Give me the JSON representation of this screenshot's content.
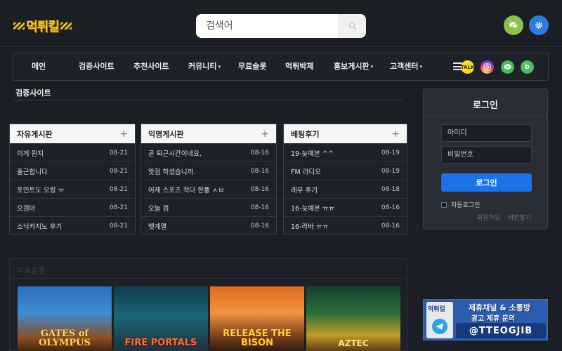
{
  "header": {
    "logo_text": "먹튀킬",
    "search": {
      "placeholder": "검색어",
      "button_icon": "search-icon"
    },
    "buttons": [
      {
        "icon": "chat-icon",
        "color": "#8bc34a"
      },
      {
        "icon": "gear-icon",
        "color": "#2f7de1"
      }
    ]
  },
  "nav": {
    "items": [
      {
        "label": "메인",
        "dropdown": false
      },
      {
        "label": "검증사이트",
        "dropdown": false
      },
      {
        "label": "추천사이트",
        "dropdown": false
      },
      {
        "label": "커뮤니티",
        "dropdown": true
      },
      {
        "label": "무료슬롯",
        "dropdown": false
      },
      {
        "label": "먹튀박제",
        "dropdown": false
      },
      {
        "label": "홍보게시판",
        "dropdown": true
      },
      {
        "label": "고객센터",
        "dropdown": true
      }
    ],
    "caret": "▾",
    "social": [
      {
        "icon": "kakaotalk-icon",
        "label": "TALK"
      },
      {
        "icon": "instagram-icon"
      },
      {
        "icon": "line-icon"
      },
      {
        "icon": "band-icon",
        "label": "b"
      }
    ]
  },
  "section": {
    "title": "검증사이트"
  },
  "boards": [
    {
      "title": "자유게시판",
      "plus": "+",
      "posts": [
        {
          "title": "이게 뭔지",
          "date": "08-21"
        },
        {
          "title": "출근합니다",
          "date": "08-21"
        },
        {
          "title": "포인트도 오링 ㅠ",
          "date": "08-21"
        },
        {
          "title": "오겜마",
          "date": "08-21"
        },
        {
          "title": "소닉카지노 후기",
          "date": "08-21"
        }
      ]
    },
    {
      "title": "익명게시판",
      "plus": "+",
      "posts": [
        {
          "title": "곧 퇴근시간이네요.",
          "date": "08-16"
        },
        {
          "title": "맛점 하셨습니까.",
          "date": "08-16"
        },
        {
          "title": "어제 스포츠 적다 한폴 ㅅㅂ",
          "date": "08-16"
        },
        {
          "title": "오늘 겜",
          "date": "08-16"
        },
        {
          "title": "벳계열",
          "date": "08-16"
        }
      ]
    },
    {
      "title": "베팅후기",
      "plus": "+",
      "posts": [
        {
          "title": "19-늦예본 ^^",
          "date": "08-19"
        },
        {
          "title": "FM 라디오",
          "date": "08-19"
        },
        {
          "title": "레부 후기",
          "date": "08-18"
        },
        {
          "title": "16-늦예본 ㅠㅠ",
          "date": "08-16"
        },
        {
          "title": "16-라바 ㅠㅠ",
          "date": "08-16"
        }
      ]
    }
  ],
  "slots": {
    "header": "무료슬롯",
    "games": [
      {
        "title": "GATES of OLYMPUS"
      },
      {
        "title": "FIRE PORTALS"
      },
      {
        "title": "RELEASE THE BISON"
      },
      {
        "title": "AZTEC"
      }
    ]
  },
  "login": {
    "title": "로그인",
    "id_placeholder": "아이디",
    "pw_placeholder": "비밀번호",
    "button": "로그인",
    "auto_login": "자동로그인",
    "links": [
      "회원가입",
      "비번찾기"
    ]
  },
  "banner": {
    "logo_text": "먹튀킬",
    "line1": "제휴채널 & 소통방",
    "line2": "광고 제휴 문의",
    "handle": "@TTEOGJIB",
    "icon": "telegram-icon"
  }
}
